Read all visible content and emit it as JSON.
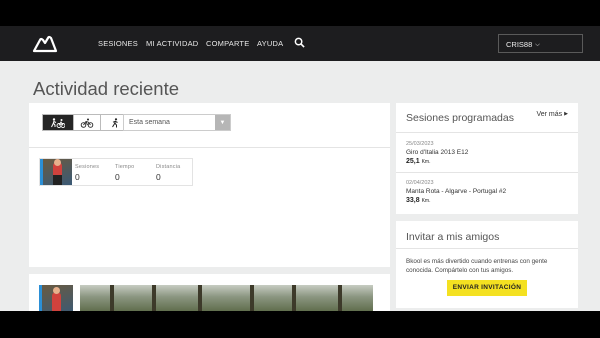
{
  "nav": {
    "items": [
      {
        "label": "SESIONES"
      },
      {
        "label": "MI ACTIVIDAD"
      },
      {
        "label": "COMPARTE"
      },
      {
        "label": "AYUDA"
      }
    ],
    "user": "CRIS88"
  },
  "page": {
    "title": "Actividad reciente"
  },
  "filters": {
    "sports": [
      "all-sports-icon",
      "cycling-icon",
      "running-icon"
    ],
    "active_sport": "all-sports-icon",
    "period": "Esta semana"
  },
  "summary": {
    "sessions_label": "Sesiones",
    "sessions_value": "0",
    "time_label": "Tiempo",
    "time_value": "0",
    "distance_label": "Distancia",
    "distance_value": "0"
  },
  "scheduled": {
    "title": "Sesiones programadas",
    "see_more": "Ver más",
    "items": [
      {
        "date": "25/03/2023",
        "name": "Giro d'Italia 2013 E12",
        "distance": "25,1",
        "unit": "Km."
      },
      {
        "date": "02/04/2023",
        "name": "Manta Rota - Algarve - Portugal #2",
        "distance": "33,8",
        "unit": "Km."
      }
    ]
  },
  "invite": {
    "title": "Invitar a mis amigos",
    "text": "Bkool es más divertido cuando entrenas con gente conocida. Compártelo con tus amigos.",
    "button": "ENVIAR INVITACIÓN"
  },
  "colors": {
    "navbar": "#1d1d1f",
    "background": "#eceded",
    "accent_button": "#f4e121",
    "active_filter": "#252525"
  }
}
